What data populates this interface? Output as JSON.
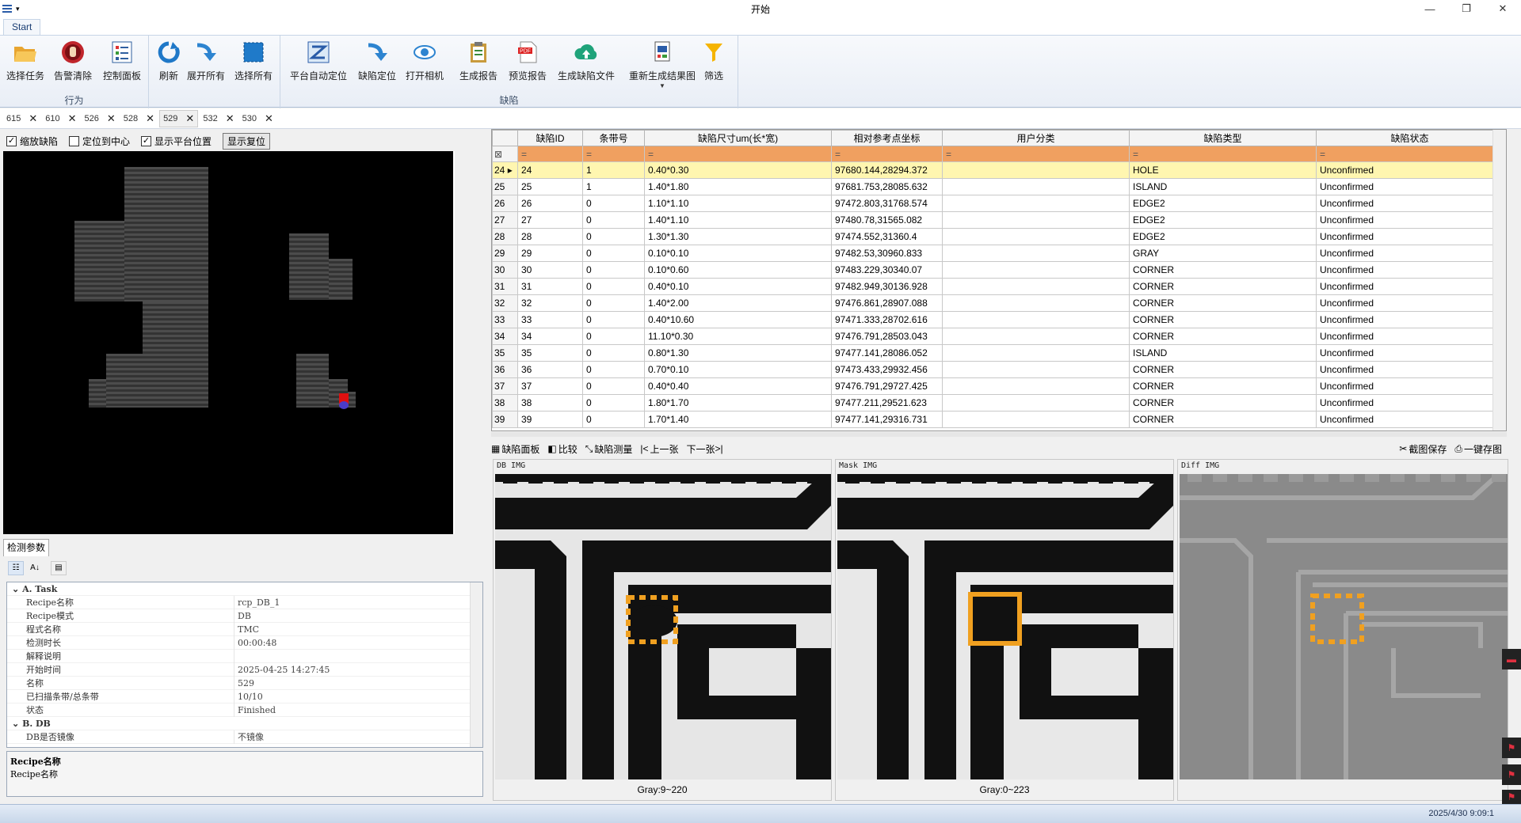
{
  "window": {
    "title": "开始"
  },
  "ribbon": {
    "tab": "Start",
    "groups": [
      {
        "label": "行为",
        "buttons": [
          "选择任务",
          "告警清除",
          "控制面板"
        ]
      },
      {
        "label": "",
        "buttons": [
          "刷新",
          "展开所有",
          "选择所有"
        ]
      },
      {
        "label": "缺陷",
        "buttons": [
          "平台自动定位",
          "缺陷定位",
          "打开相机",
          "生成报告",
          "预览报告",
          "生成缺陷文件",
          "重新生成结果图",
          "筛选"
        ]
      }
    ]
  },
  "doc_tabs": [
    "615",
    "610",
    "526",
    "528",
    "529",
    "532",
    "530"
  ],
  "active_doc_tab": "529",
  "view_options": {
    "zoom_defect": "缩放缺陷",
    "center": "定位到中心",
    "show_platform": "显示平台位置",
    "reset_button": "显示复位",
    "zoom_defect_checked": true,
    "center_checked": false,
    "show_platform_checked": true
  },
  "params": {
    "tab": "检测参数",
    "categories": [
      {
        "name": "A. Task",
        "rows": [
          {
            "k": "Recipe名称",
            "v": "rcp_DB_1"
          },
          {
            "k": "Recipe模式",
            "v": "DB"
          },
          {
            "k": "程式名称",
            "v": "TMC"
          },
          {
            "k": "检测时长",
            "v": "00:00:48"
          },
          {
            "k": "解释说明",
            "v": ""
          },
          {
            "k": "开始时间",
            "v": "2025-04-25 14:27:45"
          },
          {
            "k": "名称",
            "v": "529"
          },
          {
            "k": "已扫描条带/总条带",
            "v": "10/10"
          },
          {
            "k": "状态",
            "v": "Finished"
          }
        ]
      },
      {
        "name": "B. DB",
        "rows": [
          {
            "k": "DB是否镜像",
            "v": "不镜像"
          }
        ]
      }
    ],
    "desc_title": "Recipe名称",
    "desc_text": "Recipe名称"
  },
  "grid": {
    "columns": [
      "缺陷ID",
      "条带号",
      "缺陷尺寸um(长*宽)",
      "相对参考点坐标",
      "用户分类",
      "缺陷类型",
      "缺陷状态"
    ],
    "filter_symbol": "=",
    "rows": [
      [
        "24",
        "24",
        "1",
        "0.40*0.30",
        "97680.144,28294.372",
        "",
        "HOLE",
        "Unconfirmed"
      ],
      [
        "25",
        "25",
        "1",
        "1.40*1.80",
        "97681.753,28085.632",
        "",
        "ISLAND",
        "Unconfirmed"
      ],
      [
        "26",
        "26",
        "0",
        "1.10*1.10",
        "97472.803,31768.574",
        "",
        "EDGE2",
        "Unconfirmed"
      ],
      [
        "27",
        "27",
        "0",
        "1.40*1.10",
        "97480.78,31565.082",
        "",
        "EDGE2",
        "Unconfirmed"
      ],
      [
        "28",
        "28",
        "0",
        "1.30*1.30",
        "97474.552,31360.4",
        "",
        "EDGE2",
        "Unconfirmed"
      ],
      [
        "29",
        "29",
        "0",
        "0.10*0.10",
        "97482.53,30960.833",
        "",
        "GRAY",
        "Unconfirmed"
      ],
      [
        "30",
        "30",
        "0",
        "0.10*0.60",
        "97483.229,30340.07",
        "",
        "CORNER",
        "Unconfirmed"
      ],
      [
        "31",
        "31",
        "0",
        "0.40*0.10",
        "97482.949,30136.928",
        "",
        "CORNER",
        "Unconfirmed"
      ],
      [
        "32",
        "32",
        "0",
        "1.40*2.00",
        "97476.861,28907.088",
        "",
        "CORNER",
        "Unconfirmed"
      ],
      [
        "33",
        "33",
        "0",
        "0.40*10.60",
        "97471.333,28702.616",
        "",
        "CORNER",
        "Unconfirmed"
      ],
      [
        "34",
        "34",
        "0",
        "11.10*0.30",
        "97476.791,28503.043",
        "",
        "CORNER",
        "Unconfirmed"
      ],
      [
        "35",
        "35",
        "0",
        "0.80*1.30",
        "97477.141,28086.052",
        "",
        "ISLAND",
        "Unconfirmed"
      ],
      [
        "36",
        "36",
        "0",
        "0.70*0.10",
        "97473.433,29932.456",
        "",
        "CORNER",
        "Unconfirmed"
      ],
      [
        "37",
        "37",
        "0",
        "0.40*0.40",
        "97476.791,29727.425",
        "",
        "CORNER",
        "Unconfirmed"
      ],
      [
        "38",
        "38",
        "0",
        "1.80*1.70",
        "97477.211,29521.623",
        "",
        "CORNER",
        "Unconfirmed"
      ],
      [
        "39",
        "39",
        "0",
        "1.70*1.40",
        "97477.141,29316.731",
        "",
        "CORNER",
        "Unconfirmed"
      ]
    ]
  },
  "image_tools": {
    "left": [
      "缺陷面板",
      "比较",
      "缺陷测量",
      "上一张",
      "下一张"
    ],
    "right": [
      "截图保存",
      "一键存图"
    ]
  },
  "images": [
    {
      "title": "DB IMG",
      "gray": "Gray:9~220"
    },
    {
      "title": "Mask IMG",
      "gray": "Gray:0~223"
    },
    {
      "title": "Diff IMG",
      "gray": ""
    }
  ],
  "status": {
    "time": "2025/4/30 9:09:1"
  },
  "colors": {
    "filter_row": "#f0a060",
    "selected_row": "#fff6b0",
    "defect_box": "#f0a020",
    "ribbon_accent": "#1b3e74"
  }
}
